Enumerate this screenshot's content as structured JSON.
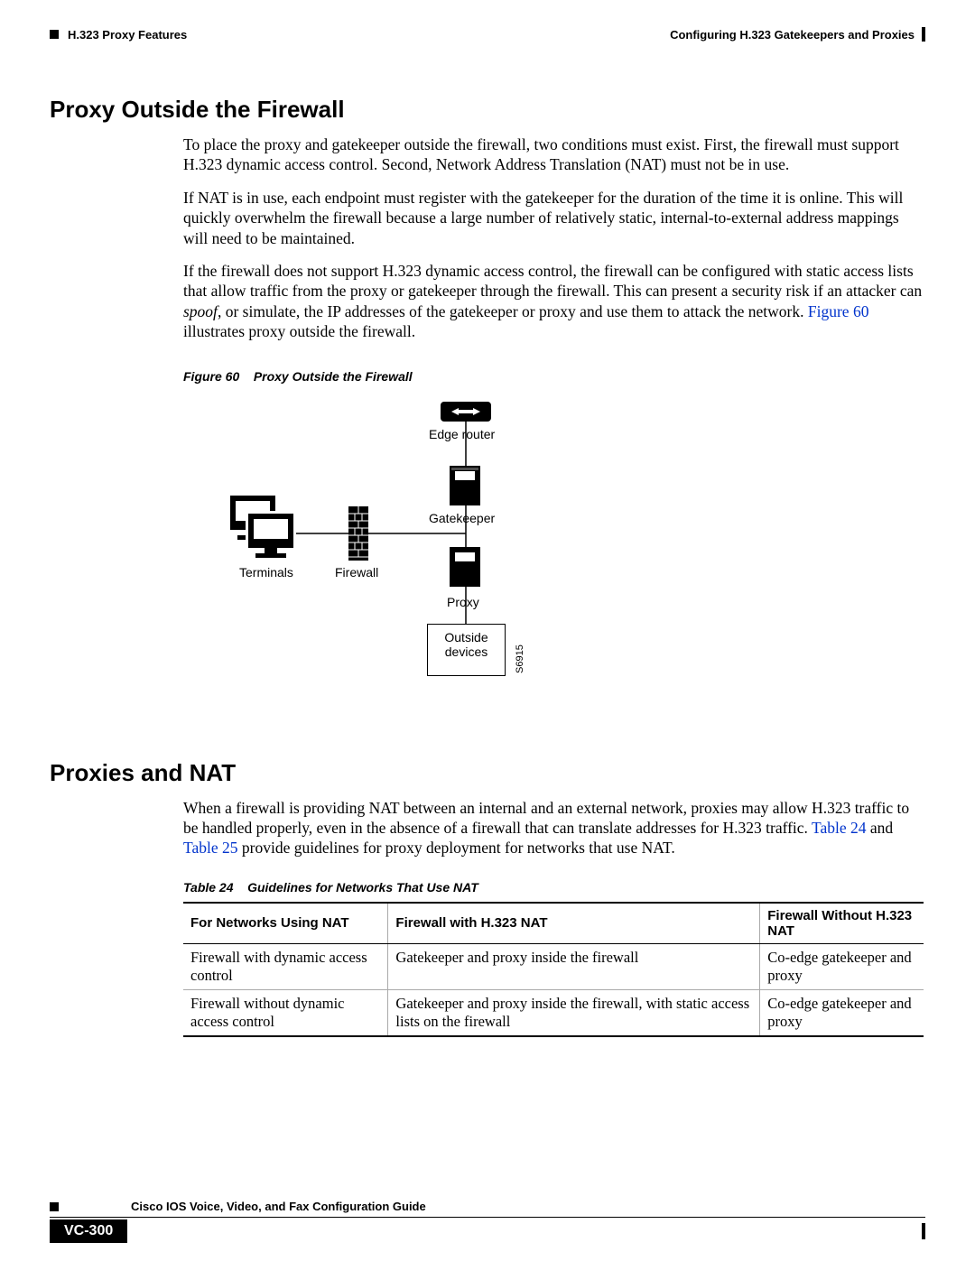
{
  "header": {
    "left": "H.323 Proxy Features",
    "right": "Configuring H.323 Gatekeepers and Proxies"
  },
  "section1": {
    "title": "Proxy Outside the Firewall",
    "para1": "To place the proxy and gatekeeper outside the firewall, two conditions must exist. First, the firewall must support H.323 dynamic access control. Second, Network Address Translation (NAT) must not be in use.",
    "para2": "If NAT is in use, each endpoint must register with the gatekeeper for the duration of the time it is online. This will quickly overwhelm the firewall because a large number of relatively static, internal-to-external address mappings will need to be maintained.",
    "para3a": "If the firewall does not support H.323 dynamic access control, the firewall can be configured with static access lists that allow traffic from the proxy or gatekeeper through the firewall. This can present a security risk if an attacker can ",
    "para3_italic": "spoof",
    "para3b": ", or simulate, the IP addresses of the gatekeeper or proxy and use them to attack the network. ",
    "para3_link": "Figure 60",
    "para3c": " illustrates proxy outside the firewall."
  },
  "figure": {
    "caption_prefix": "Figure 60",
    "caption_title": "Proxy Outside the Firewall",
    "labels": {
      "edge_router": "Edge router",
      "gatekeeper": "Gatekeeper",
      "proxy": "Proxy",
      "outside_devices_1": "Outside",
      "outside_devices_2": "devices",
      "terminals": "Terminals",
      "firewall": "Firewall",
      "side_id": "S6915"
    }
  },
  "section2": {
    "title": "Proxies and NAT",
    "para1a": "When a firewall is providing NAT between an internal and an external network, proxies may allow H.323 traffic to be handled properly, even in the absence of a firewall that can translate addresses for H.323 traffic. ",
    "para1_link1": "Table 24",
    "para1b": " and ",
    "para1_link2": "Table 25",
    "para1c": " provide guidelines for proxy deployment for networks that use NAT."
  },
  "table": {
    "caption_prefix": "Table 24",
    "caption_title": "Guidelines for Networks That Use NAT",
    "headers": [
      "For Networks Using NAT",
      "Firewall with H.323 NAT",
      "Firewall Without H.323 NAT"
    ],
    "rows": [
      [
        "Firewall with dynamic access control",
        "Gatekeeper and proxy inside the firewall",
        "Co-edge gatekeeper and proxy"
      ],
      [
        "Firewall without dynamic access control",
        "Gatekeeper and proxy inside the firewall, with static access lists on the firewall",
        "Co-edge gatekeeper and proxy"
      ]
    ]
  },
  "footer": {
    "guide": "Cisco IOS Voice, Video, and Fax Configuration Guide",
    "page": "VC-300"
  }
}
